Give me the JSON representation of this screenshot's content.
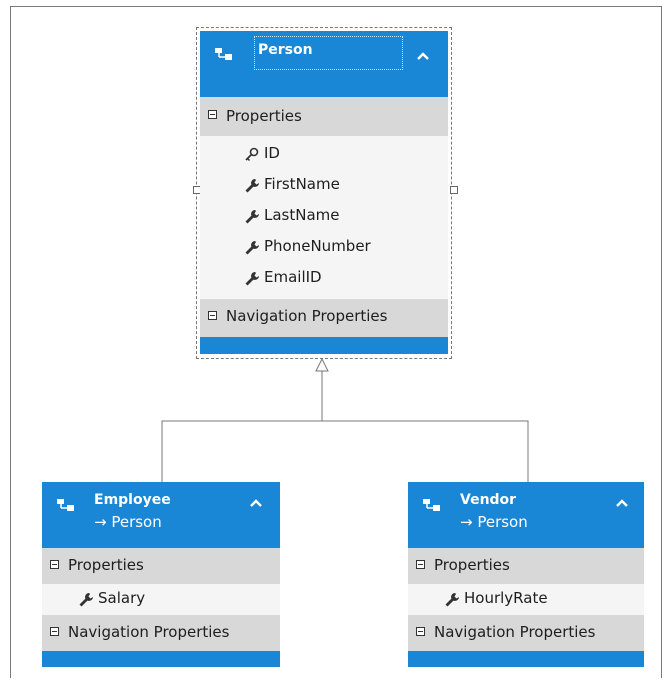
{
  "person": {
    "title": "Person",
    "properties_label": "Properties",
    "properties": [
      {
        "name": "ID",
        "icon": "key-icon"
      },
      {
        "name": "FirstName",
        "icon": "wrench-icon"
      },
      {
        "name": "LastName",
        "icon": "wrench-icon"
      },
      {
        "name": "PhoneNumber",
        "icon": "wrench-icon"
      },
      {
        "name": "EmailID",
        "icon": "wrench-icon"
      }
    ],
    "navigation_label": "Navigation Properties"
  },
  "employee": {
    "title": "Employee",
    "base_type": "→ Person",
    "properties_label": "Properties",
    "properties": [
      {
        "name": "Salary",
        "icon": "wrench-icon"
      }
    ],
    "navigation_label": "Navigation Properties"
  },
  "vendor": {
    "title": "Vendor",
    "base_type": "→ Person",
    "properties_label": "Properties",
    "properties": [
      {
        "name": "HourlyRate",
        "icon": "wrench-icon"
      }
    ],
    "navigation_label": "Navigation Properties"
  },
  "colors": {
    "header": "#1a86d6",
    "section": "#d8d8d8",
    "body": "#f5f5f5"
  }
}
